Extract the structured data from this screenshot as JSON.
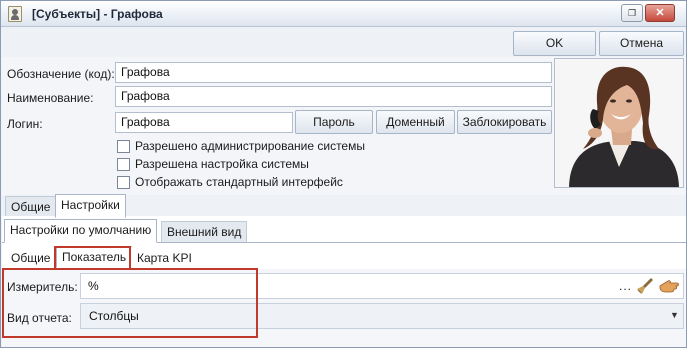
{
  "window": {
    "title": "[Субъекты] - Графова",
    "restore_glyph": "❐",
    "close_glyph": "✕"
  },
  "toolbar": {
    "ok_label": "OK",
    "cancel_label": "Отмена"
  },
  "form": {
    "code_label": "Обозначение (код):",
    "code_value": "Графова",
    "name_label": "Наименование:",
    "name_value": "Графова",
    "login_label": "Логин:",
    "login_value": "Графова",
    "password_button": "Пароль",
    "domain_button": "Доменный",
    "block_button": "Заблокировать",
    "checkboxes": [
      {
        "label": "Разрешено администрирование системы",
        "checked": false
      },
      {
        "label": "Разрешена настройка системы",
        "checked": false
      },
      {
        "label": "Отображать стандартный интерфейс",
        "checked": false
      }
    ]
  },
  "tabs_main": [
    {
      "label": "Общие",
      "active": false
    },
    {
      "label": "Настройки",
      "active": true
    }
  ],
  "tabs_settings": [
    {
      "label": "Настройки по умолчанию",
      "active": true
    },
    {
      "label": "Внешний вид",
      "active": false
    }
  ],
  "tabs_defaults": [
    {
      "label": "Общие",
      "active": false
    },
    {
      "label": "Показатель",
      "active": true
    },
    {
      "label": "Карта KPI",
      "active": false
    }
  ],
  "measure": {
    "meter_label": "Измеритель:",
    "meter_value": "%",
    "ellipsis": "...",
    "report_label": "Вид отчета:",
    "report_value": "Столбцы"
  },
  "colors": {
    "highlight": "#c0392b",
    "accent_border": "#a8b6c8"
  },
  "icons": {
    "app": "user-card-icon",
    "clear": "broom-icon",
    "pick": "hand-pointer-icon",
    "dropdown": "chevron-down-icon"
  }
}
